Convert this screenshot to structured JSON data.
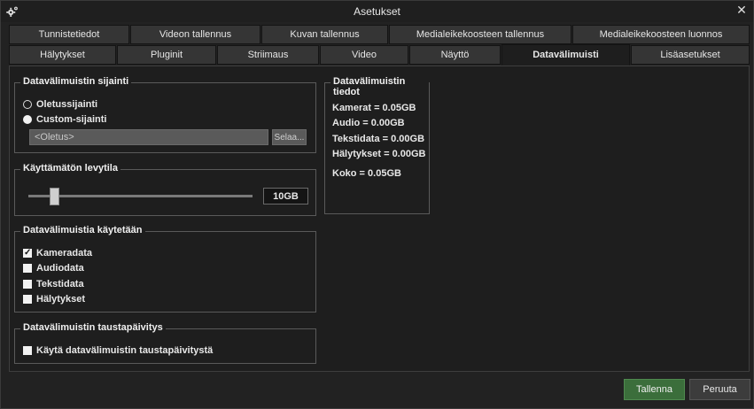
{
  "window": {
    "title": "Asetukset",
    "gear_icon": "gear-icon",
    "close_icon": "close-icon",
    "close_glyph": "✕"
  },
  "tabs_row1": [
    {
      "label": "Tunnistetiedot"
    },
    {
      "label": "Videon tallennus"
    },
    {
      "label": "Kuvan tallennus"
    },
    {
      "label": "Medialeikekoosteen tallennus"
    },
    {
      "label": "Medialeikekoosteen luonnos"
    }
  ],
  "tabs_row2": [
    {
      "label": "Hälytykset"
    },
    {
      "label": "Pluginit"
    },
    {
      "label": "Striimaus"
    },
    {
      "label": "Video"
    },
    {
      "label": "Näyttö"
    },
    {
      "label": "Datavälimuisti",
      "active": true
    },
    {
      "label": "Lisäasetukset"
    }
  ],
  "location": {
    "title": "Datavälimuistin sijainti",
    "default_label": "Oletussijainti",
    "default_selected": false,
    "custom_label": "Custom-sijainti",
    "custom_selected": true,
    "path_placeholder": "<Oletus>",
    "browse_label": "Selaa..."
  },
  "free_space": {
    "title": "Käyttämätön levytila",
    "value": "10GB",
    "slider_fraction": 0.1
  },
  "usage": {
    "title": "Datavälimuistia käytetään",
    "items": [
      {
        "label": "Kameradata",
        "checked": true
      },
      {
        "label": "Audiodata",
        "checked": false
      },
      {
        "label": "Tekstidata",
        "checked": false
      },
      {
        "label": "Hälytykset",
        "checked": false
      }
    ]
  },
  "background_update": {
    "title": "Datavälimuistin taustapäivitys",
    "label": "Käytä datavälimuistin taustapäivitystä",
    "checked": false
  },
  "info": {
    "title": "Datavälimuistin tiedot",
    "lines": [
      "Kamerat = 0.05GB",
      "Audio = 0.00GB",
      "Tekstidata = 0.00GB",
      "Hälytykset = 0.00GB"
    ],
    "total": "Koko = 0.05GB"
  },
  "footer": {
    "save_label": "Tallenna",
    "cancel_label": "Peruuta"
  },
  "colors": {
    "save_button": "#3b6e3b",
    "background": "#1e1e1e"
  }
}
